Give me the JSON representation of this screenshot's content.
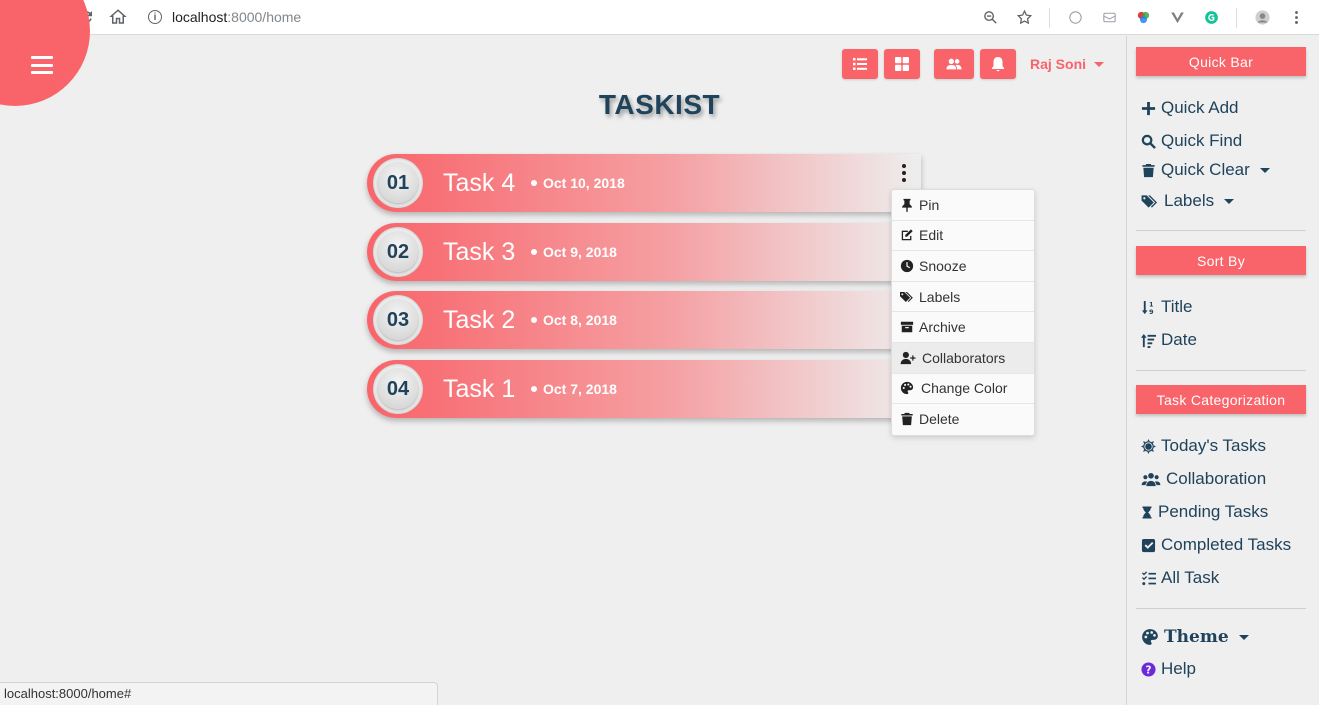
{
  "browser": {
    "url_host": "localhost",
    "url_path": ":8000/home",
    "status_url": "localhost:8000/home#"
  },
  "header": {
    "title": "TASKIST",
    "user_name": "Raj Soni"
  },
  "tasks": [
    {
      "num": "01",
      "title": "Task 4",
      "date": "Oct 10, 2018"
    },
    {
      "num": "02",
      "title": "Task 3",
      "date": "Oct 9, 2018"
    },
    {
      "num": "03",
      "title": "Task 2",
      "date": "Oct 8, 2018"
    },
    {
      "num": "04",
      "title": "Task 1",
      "date": "Oct 7, 2018"
    }
  ],
  "task_menu": [
    {
      "label": "Pin",
      "icon": "pin-icon"
    },
    {
      "label": "Edit",
      "icon": "edit-icon"
    },
    {
      "label": "Snooze",
      "icon": "clock-icon"
    },
    {
      "label": "Labels",
      "icon": "tags-icon"
    },
    {
      "label": "Archive",
      "icon": "archive-icon"
    },
    {
      "label": "Collaborators",
      "icon": "user-plus-icon"
    },
    {
      "label": "Change Color",
      "icon": "palette-icon"
    },
    {
      "label": "Delete",
      "icon": "trash-icon"
    }
  ],
  "sidebar": {
    "quick_bar": "Quick Bar",
    "quick_add": "Quick Add",
    "quick_find": "Quick Find",
    "quick_clear": "Quick Clear",
    "labels": "Labels",
    "sort_by": "Sort By",
    "sort_title": "Title",
    "sort_date": "Date",
    "task_categorization": "Task Categorization",
    "todays_tasks": "Today's Tasks",
    "collaboration": "Collaboration",
    "pending_tasks": "Pending Tasks",
    "completed_tasks": "Completed Tasks",
    "all_task": "All Task",
    "theme": "Theme",
    "help": "Help"
  },
  "colors": {
    "accent": "#f8646a",
    "text_dark": "#20435c"
  }
}
